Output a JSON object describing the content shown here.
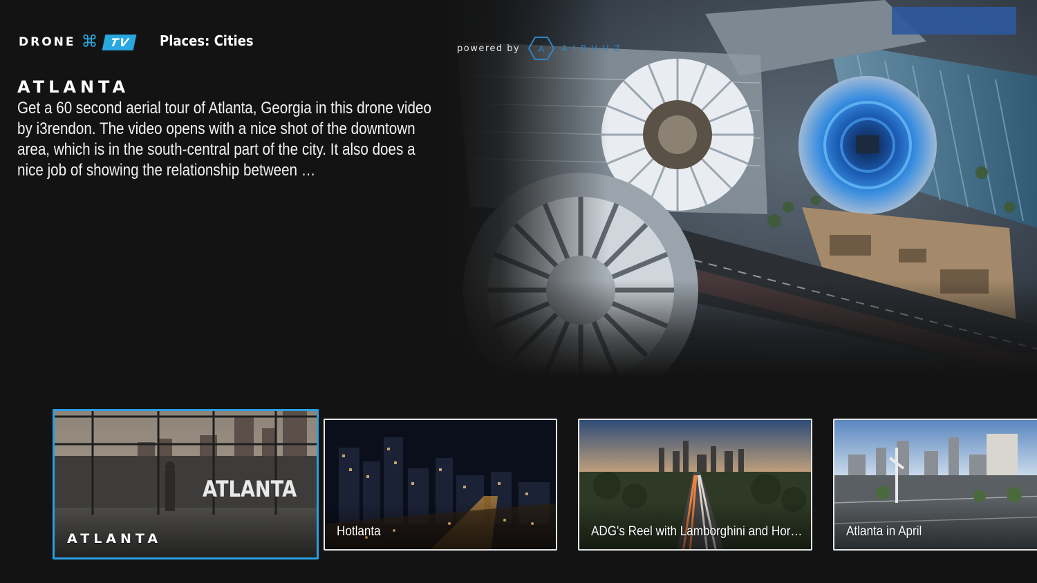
{
  "header": {
    "logo_word": "DRONE",
    "logo_tv": "TV",
    "category": "Places: Cities",
    "powered_by_label": "powered by",
    "powered_by_brand": "AIRVUZ"
  },
  "hero": {
    "title": "ATLANTA",
    "description": "Get a 60 second aerial tour of Atlanta, Georgia in this drone video by i3rendon.  The video opens with a nice shot of the downtown area, which is in the south-central part of the city.  It also does a nice job of showing the relationship between …"
  },
  "thumbnails": [
    {
      "label": "ATLANTA",
      "overlay_text": "ATLANTA",
      "focused": true
    },
    {
      "label": "Hotlanta",
      "focused": false
    },
    {
      "label": "ADG's Reel with Lamborghini and Hor…",
      "focused": false
    },
    {
      "label": "Atlanta in April",
      "focused": false
    }
  ],
  "colors": {
    "background": "#131313",
    "accent": "#29a8e0",
    "focus_border": "#2a9fe0",
    "card_border": "#e6e6e6"
  }
}
